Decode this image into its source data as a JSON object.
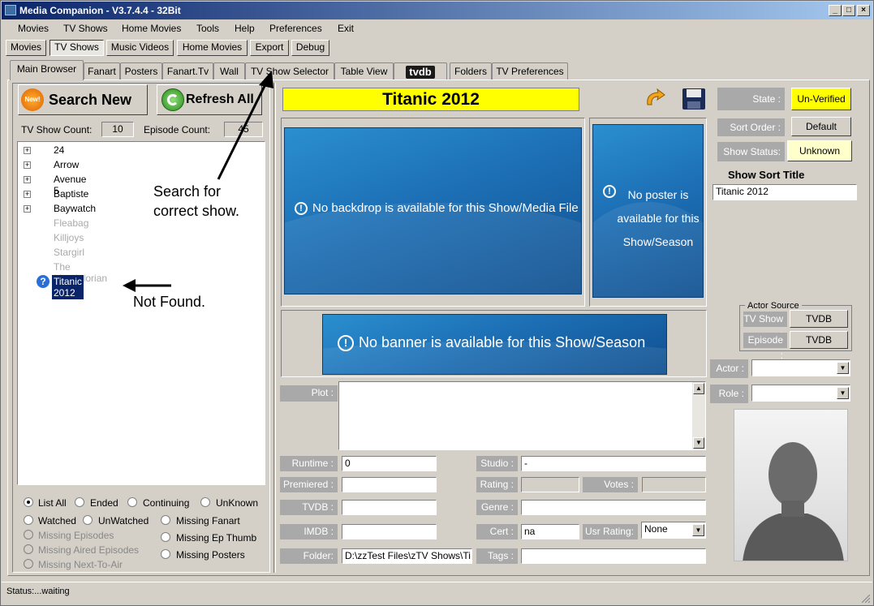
{
  "window": {
    "title": "Media Companion - V3.7.4.4 - 32Bit"
  },
  "menu": [
    "Movies",
    "TV Shows",
    "Home Movies",
    "Tools",
    "Help",
    "Preferences",
    "Exit"
  ],
  "toolbar": [
    "Movies",
    "TV Shows",
    "Music Videos",
    "Home Movies",
    "Export",
    "Debug"
  ],
  "tabs": [
    "Main Browser",
    "Fanart",
    "Posters",
    "Fanart.Tv",
    "Wall",
    "TV Show Selector",
    "Table View",
    "tvdb",
    "Folders",
    "TV Preferences"
  ],
  "left": {
    "search_new": "Search New",
    "new_badge": "New!",
    "refresh_all": "Refresh All",
    "show_count_label": "TV Show Count:",
    "show_count": "10",
    "episode_count_label": "Episode Count:",
    "episode_count": "45",
    "tree": [
      {
        "label": "24",
        "expandable": true,
        "dim": false
      },
      {
        "label": "Arrow",
        "expandable": true,
        "dim": false
      },
      {
        "label": "Avenue 5",
        "expandable": true,
        "dim": false
      },
      {
        "label": "Baptiste",
        "expandable": true,
        "dim": false
      },
      {
        "label": "Baywatch",
        "expandable": true,
        "dim": false
      },
      {
        "label": "Fleabag",
        "expandable": false,
        "dim": true
      },
      {
        "label": "Killjoys",
        "expandable": false,
        "dim": true
      },
      {
        "label": "Stargirl",
        "expandable": false,
        "dim": true
      },
      {
        "label": "The Mandalorian",
        "expandable": false,
        "dim": true
      },
      {
        "label": "Titanic 2012",
        "expandable": false,
        "dim": false
      }
    ],
    "filters": {
      "list_all": "List All",
      "ended": "Ended",
      "continuing": "Continuing",
      "unknown": "UnKnown",
      "watched": "Watched",
      "unwatched": "UnWatched",
      "missing_fanart": "Missing Fanart",
      "missing_episodes": "Missing Episodes",
      "missing_ep_thumb": "Missing Ep Thumb",
      "missing_aired_episodes": "Missing Aired Episodes",
      "missing_posters": "Missing Posters",
      "missing_next_to_air": "Missing Next-To-Air"
    }
  },
  "annotations": {
    "search_for": "Search for",
    "correct_show": "correct show.",
    "not_found": "Not Found."
  },
  "main": {
    "show_title": "Titanic 2012",
    "no_backdrop": "No backdrop is available for this Show/Media File",
    "no_poster": [
      "No poster is",
      "available for this",
      "Show/Season"
    ],
    "no_banner": "No banner is available for this Show/Season",
    "plot_label": "Plot :",
    "runtime_label": "Runtime :",
    "runtime": "0",
    "premiered_label": "Premiered :",
    "tvdb_label": "TVDB :",
    "imdb_label": "IMDB :",
    "folder_label": "Folder:",
    "folder": "D:\\zzTest Files\\zTV Shows\\Ti",
    "studio_label": "Studio :",
    "studio": "-",
    "rating_label": "Rating :",
    "votes_label": "Votes :",
    "genre_label": "Genre :",
    "cert_label": "Cert :",
    "cert": "na",
    "usr_rating_label": "Usr Rating:",
    "usr_rating": "None",
    "tags_label": "Tags :"
  },
  "right": {
    "state_label": "State :",
    "state_value": "Un-Verified",
    "sort_order_label": "Sort Order :",
    "sort_order_value": "Default",
    "show_status_label": "Show Status:",
    "show_status_value": "Unknown",
    "sort_title_heading": "Show Sort Title",
    "sort_title": "Titanic 2012",
    "actor_source_legend": "Actor Source",
    "tv_show_label": "TV Show :",
    "tv_show_src": "TVDB",
    "episode_label": "Episode :",
    "episode_src": "TVDB",
    "actor_label": "Actor :",
    "role_label": "Role :"
  },
  "status": {
    "text": "Status:...waiting"
  },
  "colors": {
    "title_yellow": "#ffff00",
    "state_yellow": "#ffff00",
    "status_yellow": "#ffffcc",
    "image_blue": "#1d6fb5"
  }
}
